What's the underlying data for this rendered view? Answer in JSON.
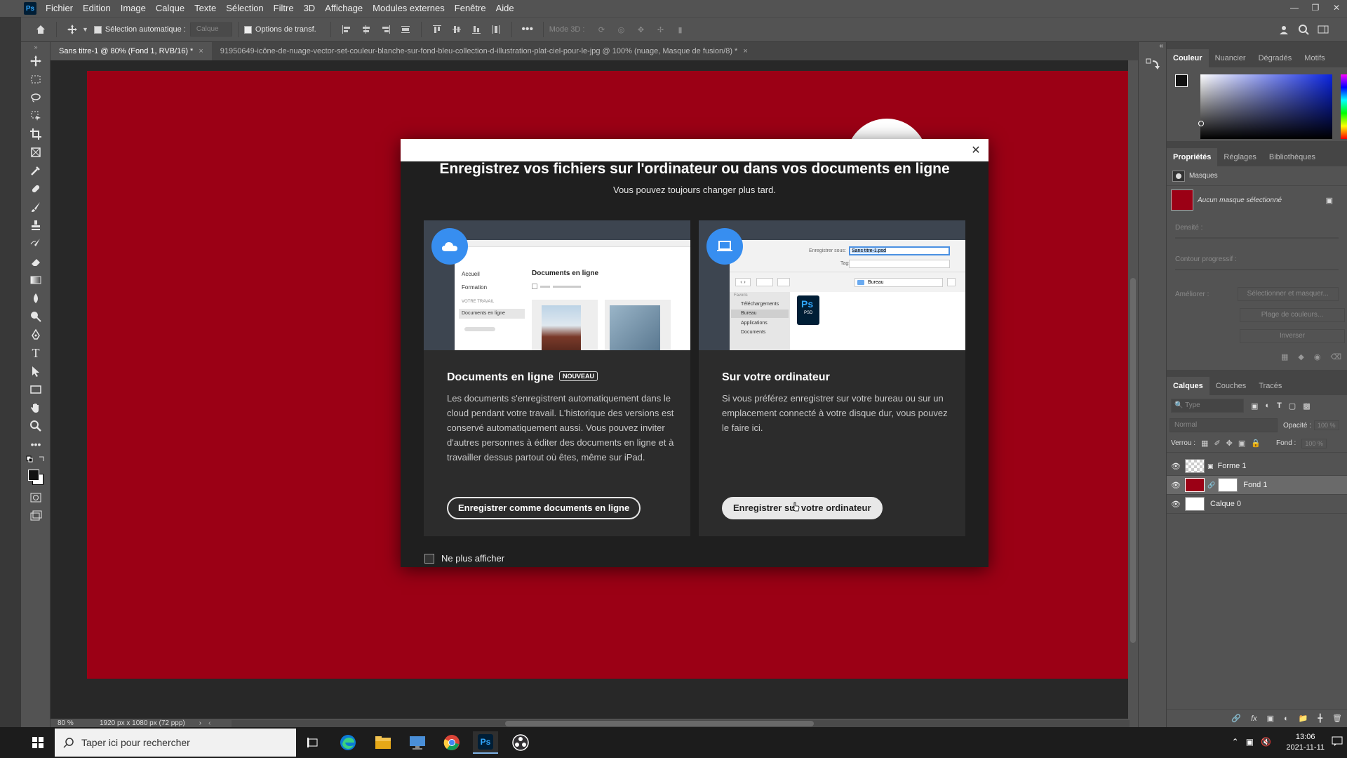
{
  "menu": {
    "logo": "Ps",
    "items": [
      "Fichier",
      "Edition",
      "Image",
      "Calque",
      "Texte",
      "Sélection",
      "Filtre",
      "3D",
      "Affichage",
      "Modules externes",
      "Fenêtre",
      "Aide"
    ]
  },
  "options": {
    "auto_select_label": "Sélection automatique :",
    "auto_select_value": "Calque",
    "transform_label": "Options de transf.",
    "mode3d_label": "Mode 3D :"
  },
  "tabs": [
    {
      "label": "Sans titre-1 @ 80% (Fond 1, RVB/16) *"
    },
    {
      "label": "91950649-icône-de-nuage-vector-set-couleur-blanche-sur-fond-bleu-collection-d-illustration-plat-ciel-pour-le-jpg @ 100% (nuage, Masque de fusion/8) *"
    }
  ],
  "status": {
    "zoom": "80 %",
    "doc_size": "1920 px x 1080 px (72 ppp)"
  },
  "panels": {
    "color_tabs": [
      "Couleur",
      "Nuancier",
      "Dégradés",
      "Motifs"
    ],
    "prop_tabs": [
      "Propriétés",
      "Réglages",
      "Bibliothèques"
    ],
    "masks_label": "Masques",
    "no_mask": "Aucun masque sélectionné",
    "density_label": "Densité :",
    "feather_label": "Contour progressif :",
    "improve_label": "Améliorer :",
    "btn_select_mask": "Sélectionner et masquer...",
    "btn_color_range": "Plage de couleurs...",
    "btn_invert": "Inverser",
    "layer_tabs": [
      "Calques",
      "Couches",
      "Tracés"
    ],
    "search_placeholder": "Type",
    "blend_mode": "Normal",
    "opacity_label": "Opacité :",
    "opacity_value": "100 %",
    "lock_label": "Verrou :",
    "fill_label": "Fond :",
    "fill_value": "100 %",
    "layers": [
      {
        "name": "Forme 1"
      },
      {
        "name": "Fond 1"
      },
      {
        "name": "Calque 0"
      }
    ]
  },
  "dialog": {
    "title": "Enregistrez vos fichiers sur l'ordinateur ou dans vos documents en ligne",
    "subtitle": "Vous pouvez toujours changer plus tard.",
    "cloud": {
      "title": "Documents en ligne",
      "badge": "NOUVEAU",
      "text": "Les documents s'enregistrent automatiquement dans le cloud pendant votre travail. L'historique des versions est conservé automatiquement aussi. Vous pouvez inviter d'autres personnes à éditer des documents en ligne et à travailler dessus partout où êtes, même sur iPad.",
      "button": "Enregistrer comme documents en ligne",
      "preview": {
        "home": "Accueil",
        "training": "Formation",
        "your_work": "VOTRE TRAVAIL",
        "docs": "Documents en ligne",
        "heading": "Documents en ligne"
      }
    },
    "local": {
      "title": "Sur votre ordinateur",
      "text": "Si vous préférez enregistrer sur votre bureau ou sur un emplacement connecté à votre disque dur, vous pouvez le faire ici.",
      "button": "Enregistrer sur votre ordinateur",
      "preview": {
        "save_as_label": "Enregistrer sous:",
        "filename": "Sans titre-1.psd",
        "tags_label": "Tags:",
        "location": "Bureau",
        "favorites": "Favoris",
        "fav_items": [
          "Téléchargements",
          "Bureau",
          "Applications",
          "Documents"
        ],
        "file_type": "PSD",
        "ps_label": "Ps"
      }
    },
    "dont_show": "Ne plus afficher"
  },
  "taskbar": {
    "search_placeholder": "Taper ici pour rechercher",
    "time": "13:06",
    "date": "2021-11-11"
  }
}
